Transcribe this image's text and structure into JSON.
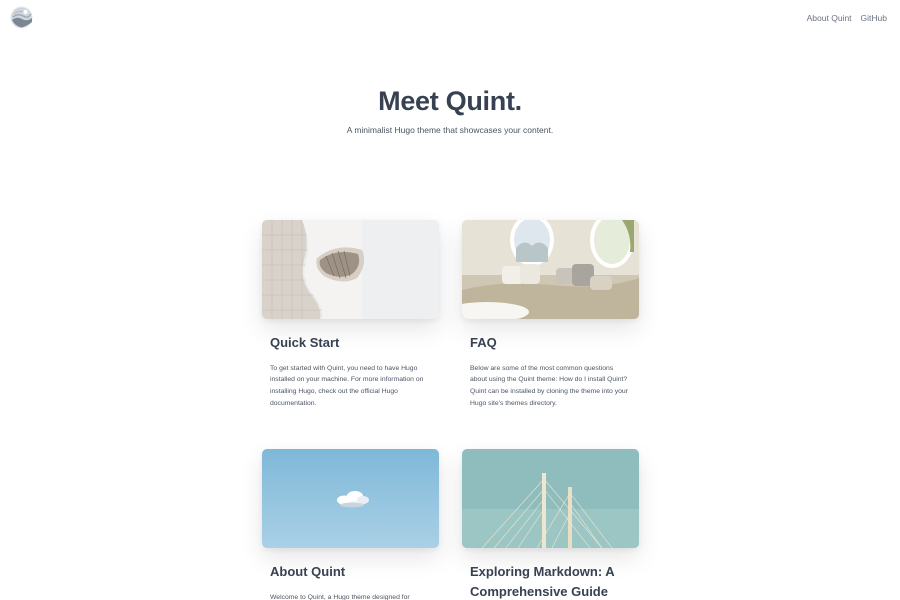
{
  "header": {
    "logo_icon": "quint-logo-icon",
    "nav": [
      {
        "label": "About Quint"
      },
      {
        "label": "GitHub"
      }
    ]
  },
  "hero": {
    "title": "Meet Quint.",
    "subtitle": "A minimalist Hugo theme that showcases your content."
  },
  "posts": [
    {
      "title": "Quick Start",
      "excerpt": "To get started with Quint, you need to have Hugo installed on your machine. For more information on installing Hugo, check out the official Hugo documentation.",
      "image_subject": "curved-white-architecture"
    },
    {
      "title": "FAQ",
      "excerpt": "Below are some of the most common questions about using the Quint theme: How do I install Quint? Quint can be installed by cloning the theme into your Hugo site's themes directory.",
      "image_subject": "lounge-interior"
    },
    {
      "title": "About Quint",
      "excerpt": "Welcome to Quint, a Hugo theme designed for",
      "image_subject": "blue-sky-cloud"
    },
    {
      "title": "Exploring Markdown: A Comprehensive Guide",
      "excerpt": "",
      "image_subject": "bridge-pylons"
    }
  ],
  "colors": {
    "text_dark": "#374151",
    "text_muted": "#6b7280",
    "background": "#ffffff"
  }
}
